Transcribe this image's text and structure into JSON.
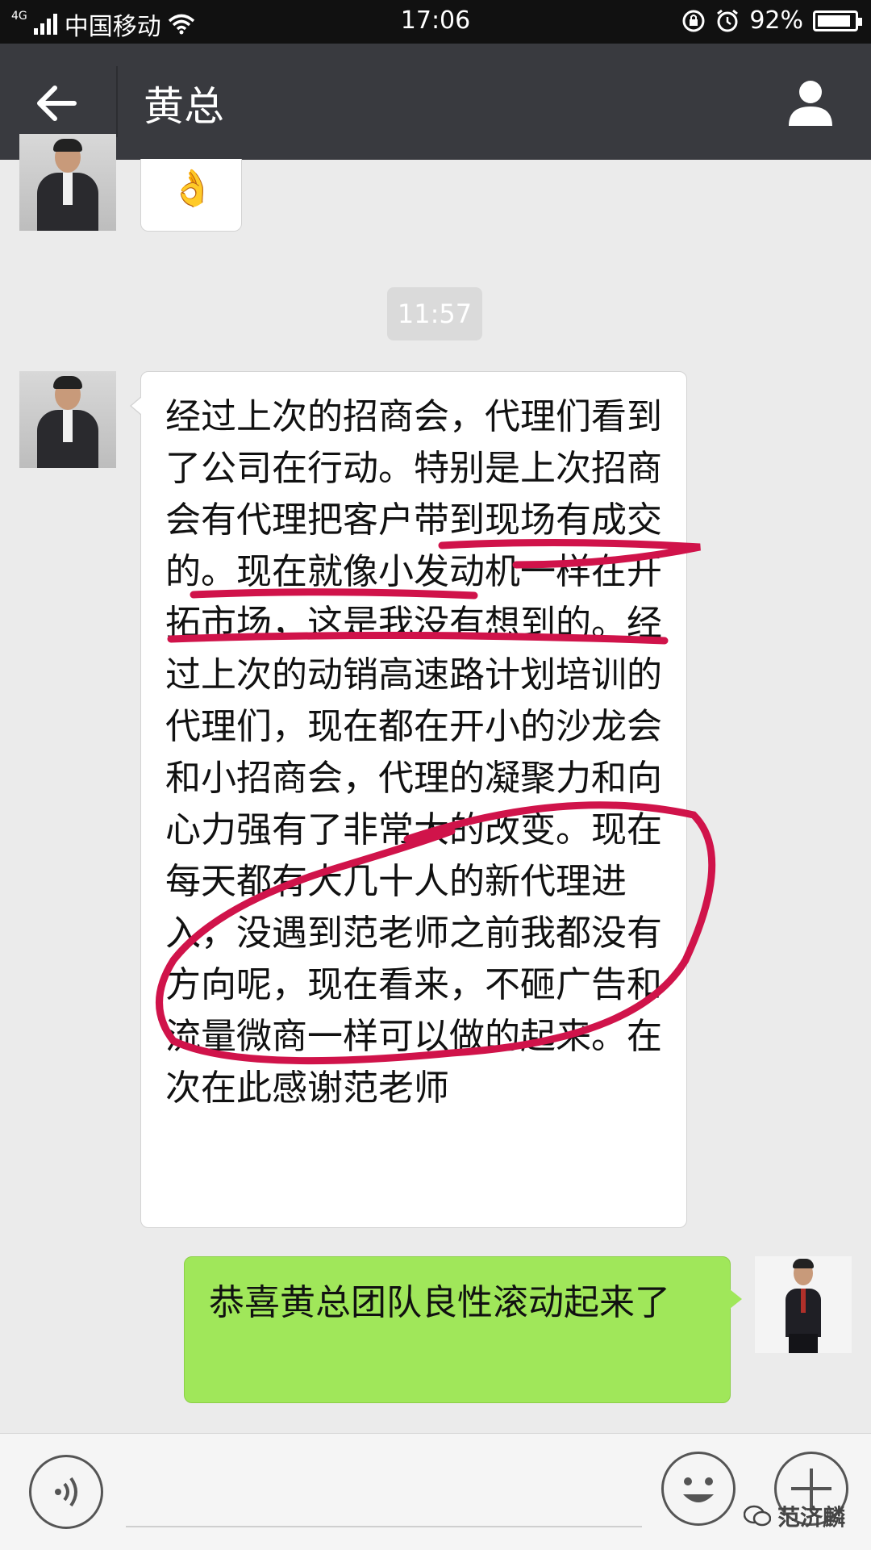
{
  "status_bar": {
    "network_small": "4G",
    "carrier": "中国移动",
    "time": "17:06",
    "battery": "92%",
    "battery_level": 0.92
  },
  "header": {
    "title": "黄总",
    "back_icon": "arrow-left-icon",
    "profile_icon": "person-icon"
  },
  "messages": [
    {
      "from": "contact",
      "type": "emoji",
      "content": "👌"
    },
    {
      "type": "timestamp",
      "content": "11:57"
    },
    {
      "from": "contact",
      "type": "text",
      "content": "经过上次的招商会，代理们看到了公司在行动。特别是上次招商会有代理把客户带到现场有成交的。现在就像小发动机一样在开拓市场，这是我没有想到的。经过上次的动销高速路计划培训的代理们，现在都在开小的沙龙会和小招商会，代理的凝聚力和向心力强有了非常大的改变。现在每天都有大几十人的新代理进入，没遇到范老师之前我都没有方向呢，现在看来，不砸广告和流量微商一样可以做的起来。在次在此感谢范老师"
    },
    {
      "from": "me",
      "type": "text",
      "content": "恭喜黄总团队良性滚动起来了"
    }
  ],
  "input_bar": {
    "voice_icon": "voice-icon",
    "emoji_icon": "smiley-icon",
    "plus_icon": "plus-icon"
  },
  "watermark": "范济麟",
  "colors": {
    "title_bar": "#393a3f",
    "chat_bg": "#ebebeb",
    "my_bubble": "#a0e75a",
    "annotation": "#d0134a"
  }
}
